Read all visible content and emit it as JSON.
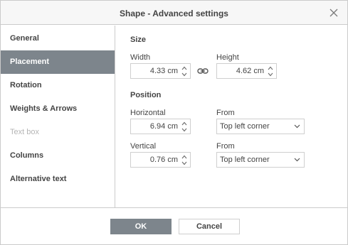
{
  "dialog": {
    "title": "Shape - Advanced settings"
  },
  "sidebar": {
    "items": [
      {
        "label": "General",
        "state": "normal"
      },
      {
        "label": "Placement",
        "state": "active"
      },
      {
        "label": "Rotation",
        "state": "normal"
      },
      {
        "label": "Weights & Arrows",
        "state": "normal"
      },
      {
        "label": "Text box",
        "state": "disabled"
      },
      {
        "label": "Columns",
        "state": "normal"
      },
      {
        "label": "Alternative text",
        "state": "normal"
      }
    ]
  },
  "size": {
    "section_label": "Size",
    "width_label": "Width",
    "width_value": "4.33 cm",
    "height_label": "Height",
    "height_value": "4.62 cm",
    "link_icon": "link-chain-icon"
  },
  "position": {
    "section_label": "Position",
    "horizontal_label": "Horizontal",
    "horizontal_value": "6.94 cm",
    "horizontal_from_label": "From",
    "horizontal_from_value": "Top left corner",
    "vertical_label": "Vertical",
    "vertical_value": "0.76 cm",
    "vertical_from_label": "From",
    "vertical_from_value": "Top left corner"
  },
  "footer": {
    "ok_label": "OK",
    "cancel_label": "Cancel"
  },
  "colors": {
    "accent": "#7d858c",
    "border": "#cbcbcb",
    "text": "#444444",
    "disabled_text": "#b5b5b5"
  }
}
